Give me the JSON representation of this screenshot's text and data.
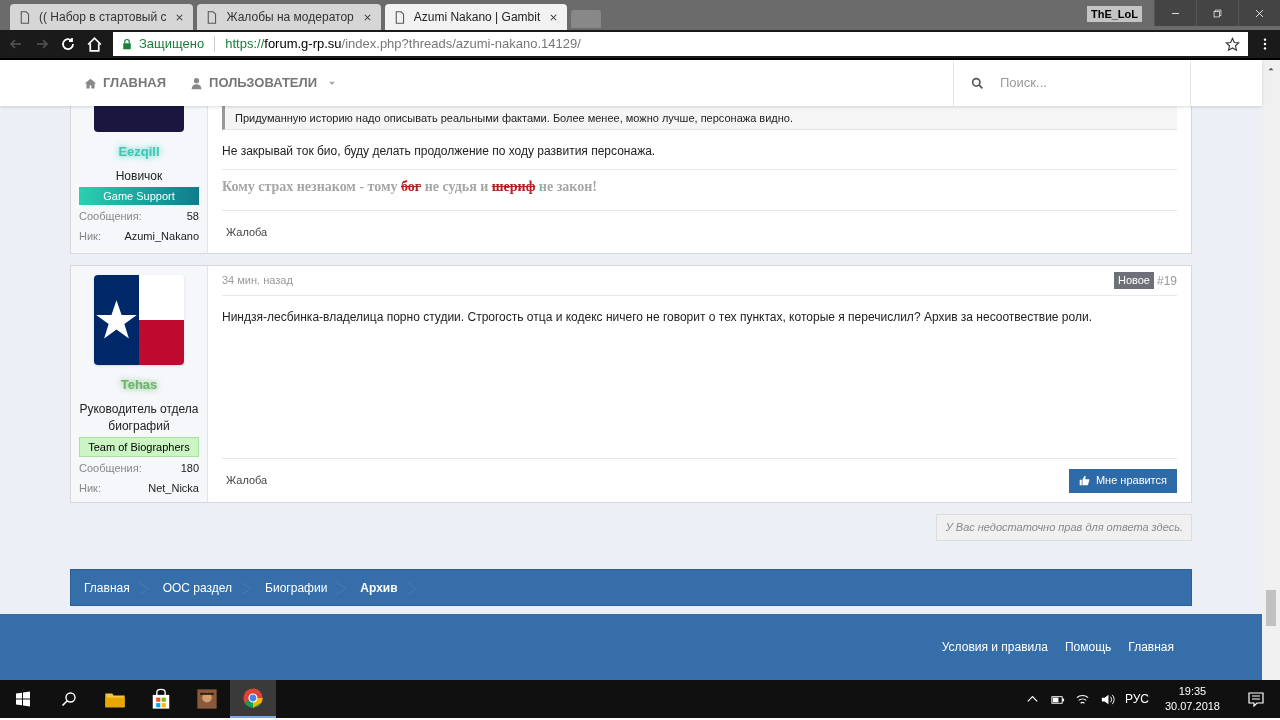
{
  "browser": {
    "tabs": [
      {
        "title": "(( Набор в стартовый с",
        "selected": false
      },
      {
        "title": "Жалобы на модератор",
        "selected": false
      },
      {
        "title": "Azumi Nakano | Gambit",
        "selected": true
      }
    ],
    "profile_name": "ThE_LoL",
    "address": {
      "secure_label": "Защищено",
      "scheme": "https://",
      "host": "forum.g-rp.su",
      "path": "/index.php?threads/azumi-nakano.14129/"
    }
  },
  "nav": {
    "items": [
      {
        "label": "ГЛАВНАЯ",
        "dropdown": false
      },
      {
        "label": "ПОЛЬЗОВАТЕЛИ",
        "dropdown": true
      }
    ],
    "search": {
      "placeholder": "Поиск..."
    }
  },
  "posts": [
    {
      "kind": "photo",
      "author": {
        "name": "Eezqill",
        "color": "#3cc8b4"
      },
      "rank": "Новичок",
      "badge": {
        "label": "Game Support",
        "kind": "support"
      },
      "stats": [
        {
          "label": "Сообщения:",
          "value": "58"
        },
        {
          "label": "Ник:",
          "value": "Azumi_Nakano"
        }
      ],
      "quote": "Придуманную историю надо описывать реальными фактами. Более менее, можно лучше, персонажа видно.",
      "body": "Не закрывай ток био, буду делать продолжение по ходу развития персонажа.",
      "signature": [
        {
          "text": "Кому страх незнаком - тому ",
          "struck": false
        },
        {
          "text": "бог",
          "struck": true
        },
        {
          "text": " не судья и ",
          "struck": false
        },
        {
          "text": "шериф",
          "struck": true
        },
        {
          "text": " не закон!",
          "struck": false
        }
      ],
      "report": "Жалоба"
    },
    {
      "kind": "flag",
      "author": {
        "name": "Tehas",
        "color": "#6ab56a"
      },
      "rank": "Руководитель отдела биографий",
      "badge": {
        "label": "Team of Biographers",
        "kind": "biographers"
      },
      "stats": [
        {
          "label": "Сообщения:",
          "value": "180"
        },
        {
          "label": "Ник:",
          "value": "Net_Nicka"
        }
      ],
      "time": "34 мин. назад",
      "new_label": "Новое",
      "number": "#19",
      "body": "Ниндзя-лесбинка-владелица порно студии. Строгость отца и кодекс ничего не говорит о тех пунктах, которые я перечислил? Архив за несоотвествие роли.",
      "report": "Жалоба",
      "like": "Мне нравится"
    }
  ],
  "reply_notice": "У Вас недостаточно прав для ответа здесь.",
  "breadcrumbs": [
    {
      "label": "Главная",
      "current": false
    },
    {
      "label": "ООС раздел",
      "current": false
    },
    {
      "label": "Биографии",
      "current": false
    },
    {
      "label": "Архив",
      "current": true
    }
  ],
  "footer_links": [
    "Условия и правила",
    "Помощь",
    "Главная"
  ],
  "taskbar": {
    "apps": [
      {
        "kind": "explorer",
        "selected": false
      },
      {
        "kind": "store",
        "selected": false
      },
      {
        "kind": "game",
        "selected": false
      },
      {
        "kind": "chrome",
        "selected": true
      }
    ],
    "lang": "РУС",
    "time": "19:35",
    "date": "30.07.2018"
  }
}
